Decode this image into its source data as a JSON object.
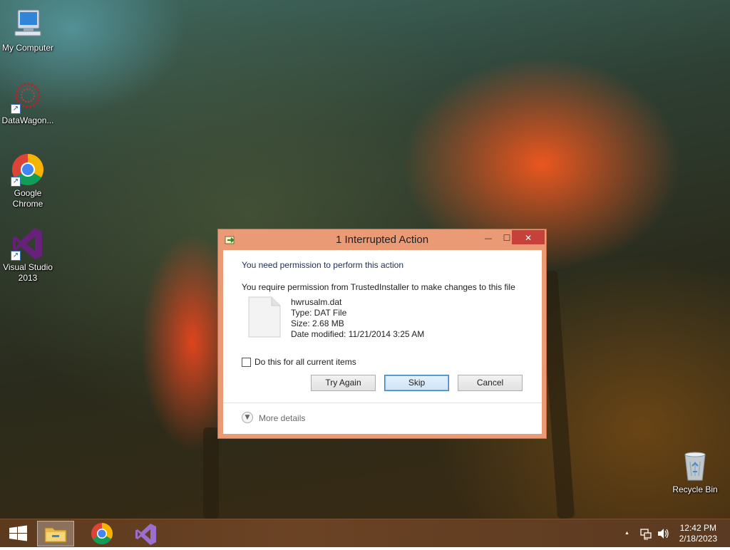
{
  "desktop": {
    "icons": [
      {
        "name": "my-computer-icon",
        "label": "My Computer"
      },
      {
        "name": "datawagon-icon",
        "label": "DataWagon..."
      },
      {
        "name": "google-chrome-icon",
        "label": "Google Chrome"
      },
      {
        "name": "visual-studio-2013-icon",
        "label": "Visual Studio 2013"
      },
      {
        "name": "recycle-bin-icon",
        "label": "Recycle Bin"
      }
    ]
  },
  "dialog": {
    "title": "1 Interrupted Action",
    "controls": {
      "minimize": "—",
      "maximize": "☐",
      "close": "✕"
    },
    "message_main": "You need permission to perform this action",
    "message_detail": "You require permission from TrustedInstaller to make changes to this file",
    "file": {
      "name": "hwrusalm.dat",
      "type": "Type: DAT File",
      "size": "Size: 2.68 MB",
      "modified": "Date modified: 11/21/2014 3:25 AM"
    },
    "checkbox_label": "Do this for all current items",
    "checkbox_checked": false,
    "buttons": {
      "try_again": "Try Again",
      "skip": "Skip",
      "cancel": "Cancel"
    },
    "more_details": "More details"
  },
  "taskbar": {
    "pinned": [
      "start-button",
      "file-explorer-icon",
      "chrome-icon",
      "visual-studio-icon"
    ],
    "tray_chevron": "▲",
    "clock": {
      "time": "12:42 PM",
      "date": "2/18/2023"
    }
  },
  "colors": {
    "dialog_frame": "#ea9a74",
    "close_button": "#c7413b",
    "taskbar": "#5c3a1e"
  }
}
